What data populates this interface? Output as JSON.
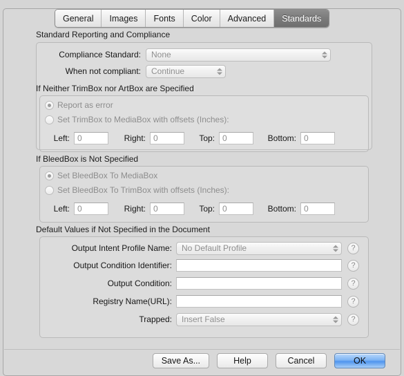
{
  "tabs": [
    {
      "label": "General",
      "selected": false
    },
    {
      "label": "Images",
      "selected": false
    },
    {
      "label": "Fonts",
      "selected": false
    },
    {
      "label": "Color",
      "selected": false
    },
    {
      "label": "Advanced",
      "selected": false
    },
    {
      "label": "Standards",
      "selected": true
    }
  ],
  "sections": {
    "reporting": {
      "title": "Standard Reporting and Compliance",
      "compliance_standard_label": "Compliance Standard:",
      "compliance_standard_value": "None",
      "when_not_compliant_label": "When not compliant:",
      "when_not_compliant_value": "Continue"
    },
    "trimbox": {
      "title": "If Neither TrimBox nor ArtBox are Specified",
      "option_report_label": "Report as error",
      "option_report_selected": true,
      "option_offsets_label": "Set TrimBox to MediaBox with offsets (Inches):",
      "option_offsets_selected": false,
      "offsets": [
        {
          "label": "Left:",
          "value": "0"
        },
        {
          "label": "Right:",
          "value": "0"
        },
        {
          "label": "Top:",
          "value": "0"
        },
        {
          "label": "Bottom:",
          "value": "0"
        }
      ]
    },
    "bleedbox": {
      "title": "If BleedBox is Not Specified",
      "option_media_label": "Set BleedBox To MediaBox",
      "option_media_selected": true,
      "option_trim_label": "Set BleedBox To TrimBox with offsets (Inches):",
      "option_trim_selected": false,
      "offsets": [
        {
          "label": "Left:",
          "value": "0"
        },
        {
          "label": "Right:",
          "value": "0"
        },
        {
          "label": "Top:",
          "value": "0"
        },
        {
          "label": "Bottom:",
          "value": "0"
        }
      ]
    },
    "defaults": {
      "title": "Default Values if Not Specified in the Document",
      "help_glyph": "?",
      "rows": [
        {
          "label": "Output Intent Profile Name:",
          "type": "popup",
          "value": "No Default Profile"
        },
        {
          "label": "Output Condition Identifier:",
          "type": "field",
          "value": ""
        },
        {
          "label": "Output Condition:",
          "type": "field",
          "value": ""
        },
        {
          "label": "Registry Name(URL):",
          "type": "field",
          "value": ""
        },
        {
          "label": "Trapped:",
          "type": "popup",
          "value": "Insert False"
        }
      ]
    }
  },
  "buttons": {
    "save_as": "Save As...",
    "help": "Help",
    "cancel": "Cancel",
    "ok": "OK"
  }
}
